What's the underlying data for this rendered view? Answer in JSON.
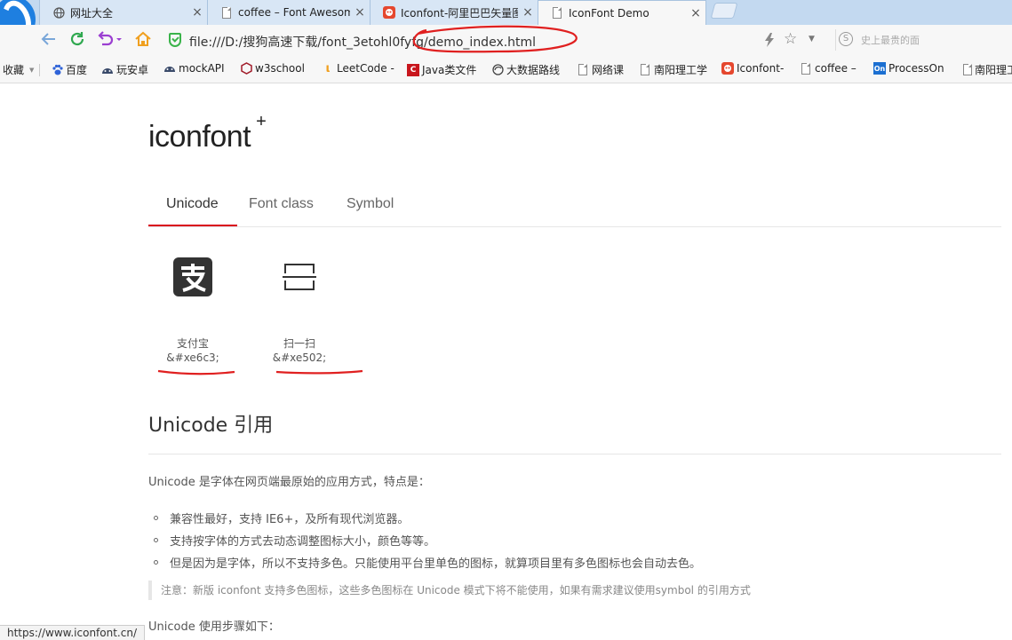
{
  "tabs": [
    {
      "title": "网址大全",
      "icon": "globe-icon",
      "close": "×"
    },
    {
      "title": "coffee – Font Awesome",
      "icon": "page-icon",
      "close": "×"
    },
    {
      "title": "Iconfont-阿里巴巴矢量图标",
      "icon": "iconfont-logo-icon",
      "close": "×"
    },
    {
      "title": "IconFont Demo",
      "icon": "page-icon",
      "close": "×"
    }
  ],
  "address": {
    "url": "file:///D:/搜狗高速下载/font_3etohl0fyfg/demo_index.html"
  },
  "search": {
    "placeholder": "史上最贵的面"
  },
  "bookmarks": [
    {
      "label": "收藏",
      "icon": "star-icon"
    },
    {
      "label": "百度",
      "icon": "paw-icon"
    },
    {
      "label": "玩安卓",
      "icon": "android-icon"
    },
    {
      "label": "mockAPI",
      "icon": "android-icon"
    },
    {
      "label": "w3school",
      "icon": "w3school-icon"
    },
    {
      "label": "LeetCode -",
      "icon": "leetcode-icon"
    },
    {
      "label": "Java类文件",
      "icon": "csdn-icon"
    },
    {
      "label": "大数据路线",
      "icon": "web-icon"
    },
    {
      "label": "网络课",
      "icon": "page-icon"
    },
    {
      "label": "南阳理工学",
      "icon": "page-icon"
    },
    {
      "label": "Iconfont-",
      "icon": "iconfont-logo-icon"
    },
    {
      "label": "coffee –",
      "icon": "page-icon"
    },
    {
      "label": "ProcessOn",
      "icon": "processon-icon"
    },
    {
      "label": "南阳理工",
      "icon": "page-icon"
    }
  ],
  "page": {
    "logo": "iconfont",
    "logo_plus": "+",
    "tabs": [
      "Unicode",
      "Font class",
      "Symbol"
    ],
    "icons": [
      {
        "name": "支付宝",
        "code": "&#xe6c3;",
        "icon": "alipay-icon"
      },
      {
        "name": "扫一扫",
        "code": "&#xe502;",
        "icon": "scan-icon"
      }
    ],
    "section_title": "Unicode 引用",
    "intro": "Unicode 是字体在网页端最原始的应用方式，特点是：",
    "bullets": [
      "兼容性最好，支持 IE6+，及所有现代浏览器。",
      "支持按字体的方式去动态调整图标大小，颜色等等。",
      "但是因为是字体，所以不支持多色。只能使用平台里单色的图标，就算项目里有多色图标也会自动去色。"
    ],
    "note": "注意：新版 iconfont 支持多色图标，这些多色图标在 Unicode 模式下将不能使用，如果有需求建议使用symbol 的引用方式",
    "steps": "Unicode 使用步骤如下："
  },
  "status_bar": "https://www.iconfont.cn/",
  "colors": {
    "accent": "#d9001b",
    "annotation": "#e02020",
    "tabstrip": "#c3d9f0"
  }
}
